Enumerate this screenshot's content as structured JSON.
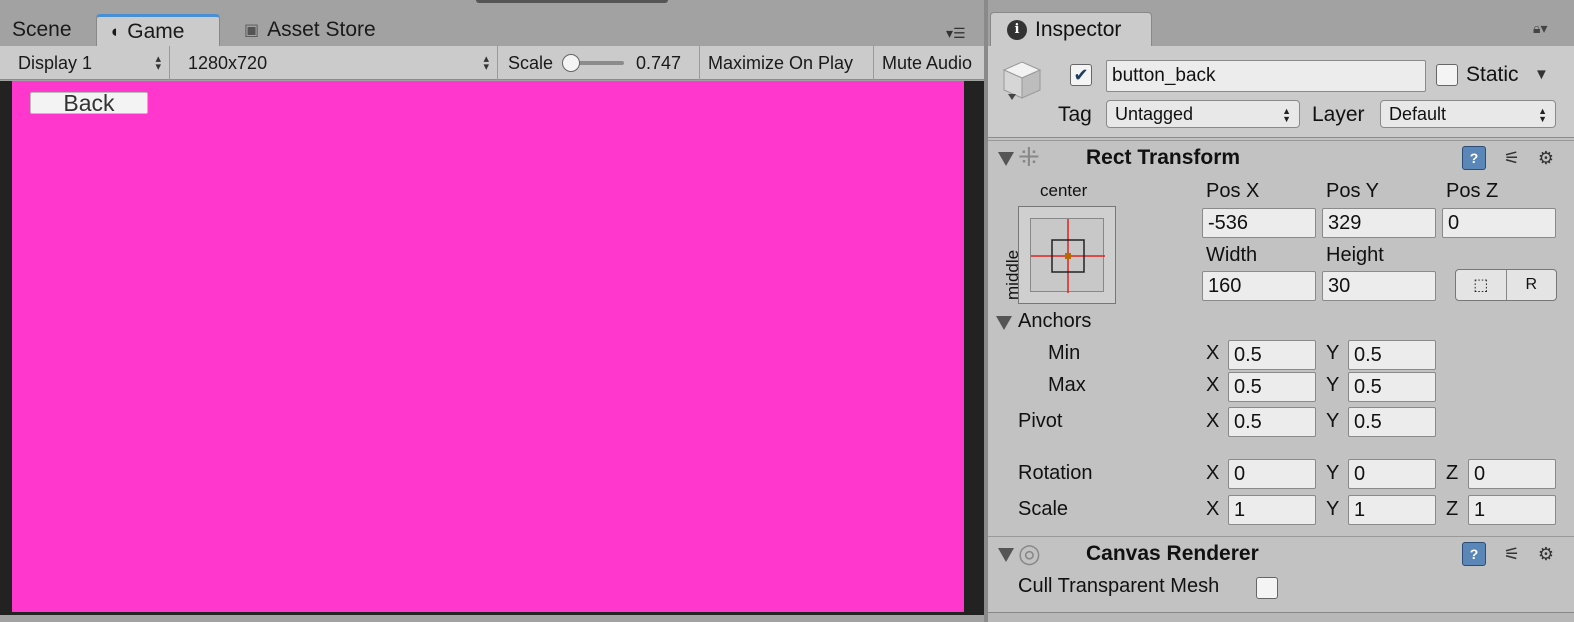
{
  "tabs": {
    "scene": "Scene",
    "game": "Game",
    "asset_store": "Asset Store"
  },
  "toolbar": {
    "display": "Display 1",
    "resolution": "1280x720",
    "scale_label": "Scale",
    "scale_value": "0.747",
    "maximize": "Maximize On Play",
    "mute": "Mute Audio"
  },
  "game": {
    "back_label": "Back",
    "canvas_color": "#ff37cc"
  },
  "inspector": {
    "tab_title": "Inspector",
    "object_name": "button_back",
    "active_checked": true,
    "static_label": "Static",
    "tag_label": "Tag",
    "tag_value": "Untagged",
    "layer_label": "Layer",
    "layer_value": "Default"
  },
  "rect_transform": {
    "title": "Rect Transform",
    "anchor_h": "center",
    "anchor_v": "middle",
    "pos_x_label": "Pos X",
    "pos_y_label": "Pos Y",
    "pos_z_label": "Pos Z",
    "pos_x": "-536",
    "pos_y": "329",
    "pos_z": "0",
    "width_label": "Width",
    "height_label": "Height",
    "width": "160",
    "height": "30",
    "anchors_label": "Anchors",
    "min_label": "Min",
    "max_label": "Max",
    "pivot_label": "Pivot",
    "min_x": "0.5",
    "min_y": "0.5",
    "max_x": "0.5",
    "max_y": "0.5",
    "pivot_x": "0.5",
    "pivot_y": "0.5",
    "rotation_label": "Rotation",
    "rot_x": "0",
    "rot_y": "0",
    "rot_z": "0",
    "scale_label": "Scale",
    "scale_x": "1",
    "scale_y": "1",
    "scale_z": "1",
    "x": "X",
    "y": "Y",
    "z": "Z"
  },
  "canvas_renderer": {
    "title": "Canvas Renderer",
    "cull_label": "Cull Transparent Mesh"
  }
}
